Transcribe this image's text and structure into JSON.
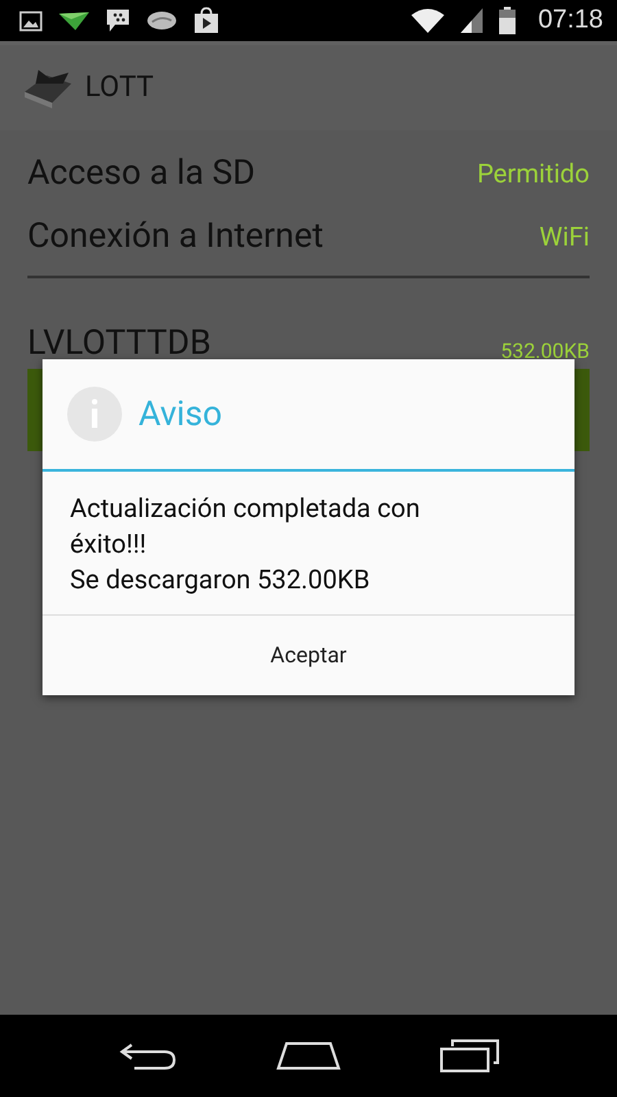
{
  "status_bar": {
    "time": "07:18"
  },
  "app_bar": {
    "title": "LOTT"
  },
  "settings": [
    {
      "label": "Acceso a la SD",
      "value": "Permitido"
    },
    {
      "label": "Conexión a Internet",
      "value": "WiFi"
    }
  ],
  "database": {
    "name": "LVLOTTTDB",
    "size": "532.00KB"
  },
  "dialog": {
    "title": "Aviso",
    "message": "Actualización completada con éxito!!!\nSe descargaron 532.00KB",
    "button": "Aceptar"
  }
}
